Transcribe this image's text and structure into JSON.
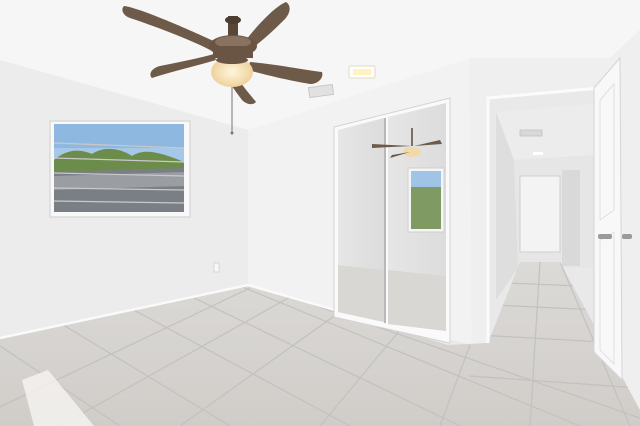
{
  "scene": {
    "kind": "empty-bedroom-interior",
    "elements": [
      "ceiling-fan",
      "window",
      "mirrored-closet-doors",
      "open-door",
      "hallway",
      "tile-floor",
      "recessed-light",
      "air-vent"
    ]
  },
  "colors": {
    "wall_left": "#ededed",
    "wall_back": "#f3f3f3",
    "wall_hall": "#e4e4e4",
    "ceiling": "#f7f7f7",
    "floor": "#d8d6d3",
    "grout": "#c4c2bf",
    "fan_blade": "#6e5a48",
    "fan_light": "#f4ddb0",
    "sky": "#9fc4e6",
    "foliage": "#6e8f4d",
    "door": "#f8f8f8"
  }
}
